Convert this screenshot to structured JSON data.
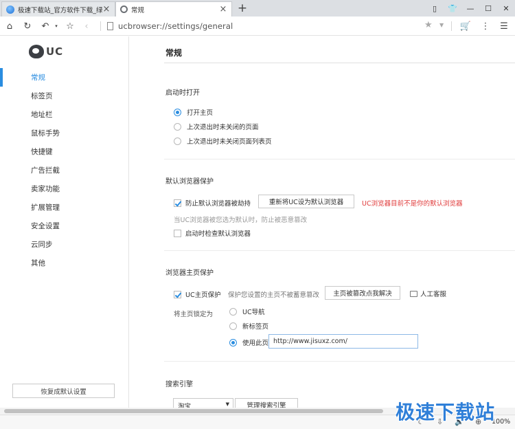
{
  "tabs": [
    {
      "title": "极速下载站_官方软件下载_绿色",
      "active": false
    },
    {
      "title": "常规",
      "active": true
    }
  ],
  "window_controls": [
    "▯",
    "👕",
    "—",
    "☐",
    "✕"
  ],
  "address": {
    "url": "ucbrowser://settings/general"
  },
  "sidebar": {
    "logo": "UC",
    "items": [
      "常规",
      "标签页",
      "地址栏",
      "鼠标手势",
      "快捷键",
      "广告拦截",
      "卖家功能",
      "扩展管理",
      "安全设置",
      "云同步",
      "其他"
    ],
    "active_index": 0,
    "reset_label": "恢复成默认设置"
  },
  "main": {
    "title": "常规",
    "startup": {
      "title": "启动时打开",
      "options": [
        "打开主页",
        "上次退出时未关闭的页面",
        "上次退出时未关闭页面列表页"
      ],
      "selected": 0
    },
    "default_browser": {
      "title": "默认浏览器保护",
      "protect_label": "防止默认浏览器被劫持",
      "protect_checked": true,
      "reset_button": "重新将UC设为默认浏览器",
      "warning": "UC浏览器目前不是你的默认浏览器",
      "hint": "当UC浏览器被您选为默认时，防止被恶意篡改",
      "check_on_start_label": "启动时检查默认浏览器",
      "check_on_start_checked": false
    },
    "homepage": {
      "title": "浏览器主页保护",
      "protect_label": "UC主页保护",
      "protect_checked": true,
      "hint": "保护您设置的主页不被蓄意篡改",
      "fix_button": "主页被篡改点我解决",
      "service_label": "人工客服",
      "lock_label": "将主页锁定为",
      "options": [
        "UC导航",
        "新标签页",
        "使用此页"
      ],
      "selected": 2,
      "custom_url": "http://www.jisuxz.com/"
    },
    "search": {
      "title": "搜索引擎",
      "engine": "淘宝",
      "manage_button": "管理搜索引擎"
    }
  },
  "statusbar": {
    "zoom": "100%"
  },
  "watermark": "极速下载站"
}
